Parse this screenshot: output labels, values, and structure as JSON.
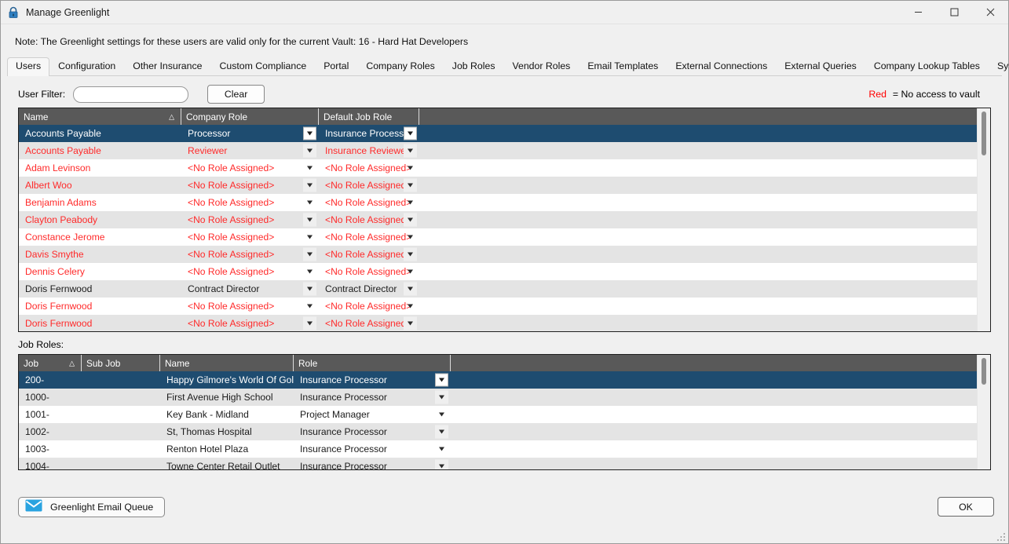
{
  "window": {
    "title": "Manage Greenlight",
    "lock_icon": "padlock-icon",
    "minimize_label": "—",
    "maximize_label": "□",
    "close_label": "✕"
  },
  "note": "Note:  The Greenlight settings for these users are valid only for the current Vault: 16 - Hard Hat Developers",
  "tabs": [
    {
      "label": "Users",
      "active": true
    },
    {
      "label": "Configuration",
      "active": false
    },
    {
      "label": "Other Insurance",
      "active": false
    },
    {
      "label": "Custom Compliance",
      "active": false
    },
    {
      "label": "Portal",
      "active": false
    },
    {
      "label": "Company Roles",
      "active": false
    },
    {
      "label": "Job Roles",
      "active": false
    },
    {
      "label": "Vendor Roles",
      "active": false
    },
    {
      "label": "Email Templates",
      "active": false
    },
    {
      "label": "External Connections",
      "active": false
    },
    {
      "label": "External Queries",
      "active": false
    },
    {
      "label": "Company Lookup Tables",
      "active": false
    },
    {
      "label": "System Lookup Tables",
      "active": false
    }
  ],
  "filter": {
    "label": "User Filter:",
    "value": "",
    "placeholder": "",
    "clear_label": "Clear"
  },
  "legend": {
    "keyword": "Red",
    "text": "= No access to vault",
    "color": "#ff0000"
  },
  "users_grid": {
    "columns": [
      "Name",
      "Company Role",
      "Default Job Role",
      ""
    ],
    "sort_column": "Name",
    "sort_indicator": "△",
    "rows": [
      {
        "name": "Accounts Payable",
        "company_role": "Processor",
        "default_job_role": "Insurance Processor",
        "selected": true,
        "no_access": false
      },
      {
        "name": "Accounts Payable",
        "company_role": "Reviewer",
        "default_job_role": "Insurance Reviewer",
        "selected": false,
        "no_access": true
      },
      {
        "name": "Adam Levinson",
        "company_role": "<No Role Assigned>",
        "default_job_role": "<No Role Assigned>",
        "selected": false,
        "no_access": true
      },
      {
        "name": "Albert Woo",
        "company_role": "<No Role Assigned>",
        "default_job_role": "<No Role Assigned>",
        "selected": false,
        "no_access": true
      },
      {
        "name": "Benjamin Adams",
        "company_role": "<No Role Assigned>",
        "default_job_role": "<No Role Assigned>",
        "selected": false,
        "no_access": true
      },
      {
        "name": "Clayton Peabody",
        "company_role": "<No Role Assigned>",
        "default_job_role": "<No Role Assigned>",
        "selected": false,
        "no_access": true
      },
      {
        "name": "Constance Jerome",
        "company_role": "<No Role Assigned>",
        "default_job_role": "<No Role Assigned>",
        "selected": false,
        "no_access": true
      },
      {
        "name": "Davis Smythe",
        "company_role": "<No Role Assigned>",
        "default_job_role": "<No Role Assigned>",
        "selected": false,
        "no_access": true
      },
      {
        "name": "Dennis Celery",
        "company_role": "<No Role Assigned>",
        "default_job_role": "<No Role Assigned>",
        "selected": false,
        "no_access": true
      },
      {
        "name": "Doris Fernwood",
        "company_role": "Contract Director",
        "default_job_role": "Contract Director",
        "selected": false,
        "no_access": false
      },
      {
        "name": "Doris Fernwood",
        "company_role": "<No Role Assigned>",
        "default_job_role": "<No Role Assigned>",
        "selected": false,
        "no_access": true
      },
      {
        "name": "Doris Fernwood",
        "company_role": "<No Role Assigned>",
        "default_job_role": "<No Role Assigned>",
        "selected": false,
        "no_access": true
      }
    ]
  },
  "job_roles_label": "Job Roles:",
  "jobs_grid": {
    "columns": [
      "Job",
      "Sub Job",
      "Name",
      "Role",
      ""
    ],
    "sort_column": "Job",
    "sort_indicator": "△",
    "rows": [
      {
        "job": "200-",
        "sub_job": "",
        "name": "Happy Gilmore's World Of Golf",
        "role": "Insurance Processor",
        "selected": true
      },
      {
        "job": "1000-",
        "sub_job": "",
        "name": "First Avenue High School",
        "role": "Insurance Processor",
        "selected": false
      },
      {
        "job": "1001-",
        "sub_job": "",
        "name": "Key Bank - Midland",
        "role": "Project Manager",
        "selected": false
      },
      {
        "job": "1002-",
        "sub_job": "",
        "name": "St, Thomas Hospital",
        "role": "Insurance Processor",
        "selected": false
      },
      {
        "job": "1003-",
        "sub_job": "",
        "name": "Renton Hotel Plaza",
        "role": "Insurance Processor",
        "selected": false
      },
      {
        "job": "1004-",
        "sub_job": "",
        "name": "Towne Center Retail Outlet",
        "role": "Insurance Processor",
        "selected": false
      }
    ]
  },
  "footer": {
    "email_queue_label": "Greenlight Email Queue",
    "email_icon": "envelope-icon",
    "ok_label": "OK"
  },
  "colors": {
    "header_bg": "#595959",
    "selection_bg": "#1e4c70",
    "no_access_text": "#ff2a2a",
    "alt_row_bg": "#e4e4e4",
    "window_bg": "#f0f0f0"
  }
}
